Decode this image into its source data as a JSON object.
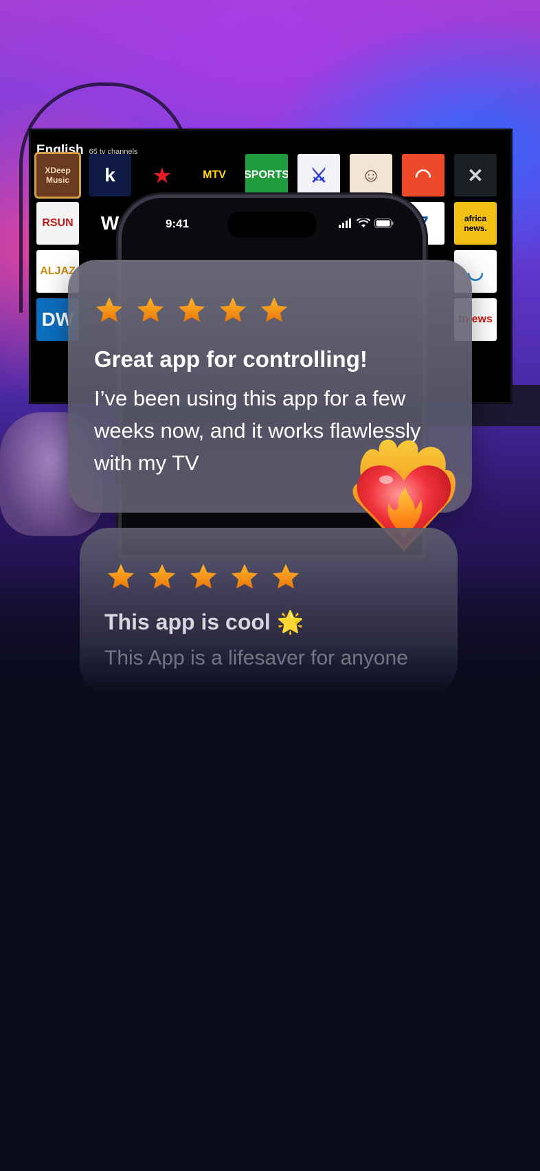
{
  "tv": {
    "language": "English",
    "channel_count": "65 tv channels",
    "tiles": [
      {
        "label": "XDeep Music",
        "bg": "#6b3a22",
        "fg": "#f1d7b0",
        "selected": true
      },
      {
        "label": "k",
        "bg": "#0f1a44",
        "fg": "#ffffff"
      },
      {
        "label": "★",
        "bg": "#000000",
        "fg": "#e51b24"
      },
      {
        "label": "MTV",
        "bg": "#000000",
        "fg": "#ffd400"
      },
      {
        "label": "SPORTS",
        "bg": "#1e9b3a",
        "fg": "#ffffff"
      },
      {
        "label": "⚔",
        "bg": "#f2f2f8",
        "fg": "#2c3fd1"
      },
      {
        "label": "☺",
        "bg": "#f3e3d3",
        "fg": "#5a3a2a"
      },
      {
        "label": "◠",
        "bg": "#ec4a2a",
        "fg": "#ffffff"
      },
      {
        "label": "✕",
        "bg": "#1b1f24",
        "fg": "#cfd6dd"
      },
      {
        "label": "RSUN",
        "bg": "#f4f4f4",
        "fg": "#c21b1b"
      },
      {
        "label": "W",
        "bg": "#000000",
        "fg": "#ffffff"
      },
      {
        "label": "7",
        "bg": "#ffffff",
        "fg": "#1557a6"
      },
      {
        "label": "africa news.",
        "bg": "#f2c012",
        "fg": "#000000"
      },
      {
        "label": "ALJAZ",
        "bg": "#ffffff",
        "fg": "#c98a12"
      },
      {
        "label": "◡",
        "bg": "#ffffff",
        "fg": "#1b7fd1"
      },
      {
        "label": "DW",
        "bg": "#0d6fbf",
        "fg": "#ffffff"
      },
      {
        "label": "tn ews",
        "bg": "#ffffff",
        "fg": "#d81b1b"
      }
    ]
  },
  "phone": {
    "time": "9:41"
  },
  "reviews": [
    {
      "stars": 5,
      "title": "Great app for controlling!",
      "body": "I’ve been using this app for a few weeks now, and it works flawlessly with my TV"
    },
    {
      "stars": 5,
      "title": "This app is cool 🌟",
      "body": "This App is a lifesaver for anyone"
    }
  ],
  "colors": {
    "background": "#0b0c1e",
    "star": "#f39a14",
    "accent_purple": "#a43fd6",
    "accent_blue": "#2a6bff"
  },
  "icons": {
    "rating": "star-icon",
    "decoration": "fire-heart-icon",
    "status": [
      "cellular-signal-icon",
      "wifi-icon",
      "battery-icon"
    ]
  }
}
